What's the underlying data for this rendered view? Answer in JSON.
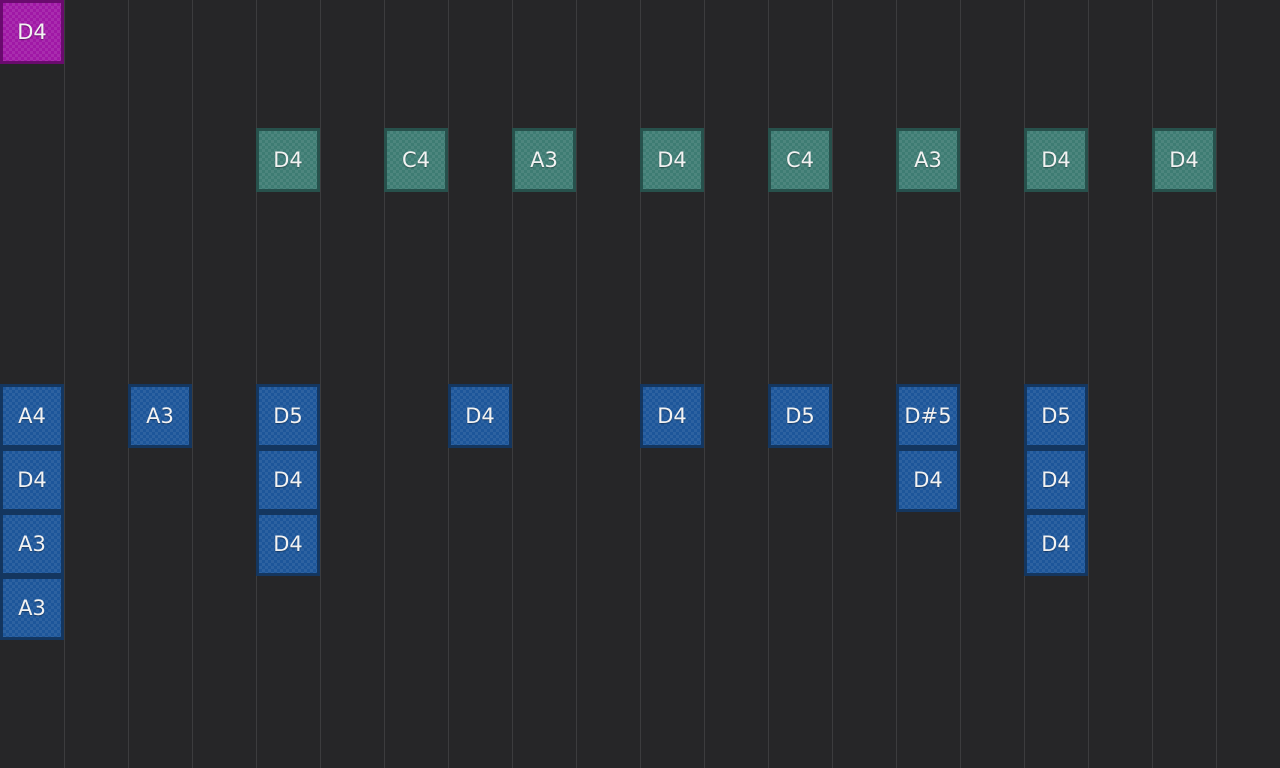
{
  "grid": {
    "columns": 20,
    "rows": 12,
    "background_color": "#262628",
    "line_color": "#3c3c3e"
  },
  "colors": {
    "blue": "#1d569a",
    "teal": "#3e7c73",
    "magenta": "#a018a6"
  },
  "notes": [
    {
      "col": 0,
      "row": 0,
      "label": "D4",
      "color": "magenta"
    },
    {
      "col": 4,
      "row": 2,
      "label": "D4",
      "color": "teal"
    },
    {
      "col": 6,
      "row": 2,
      "label": "C4",
      "color": "teal"
    },
    {
      "col": 8,
      "row": 2,
      "label": "A3",
      "color": "teal"
    },
    {
      "col": 10,
      "row": 2,
      "label": "D4",
      "color": "teal"
    },
    {
      "col": 12,
      "row": 2,
      "label": "C4",
      "color": "teal"
    },
    {
      "col": 14,
      "row": 2,
      "label": "A3",
      "color": "teal"
    },
    {
      "col": 16,
      "row": 2,
      "label": "D4",
      "color": "teal"
    },
    {
      "col": 18,
      "row": 2,
      "label": "D4",
      "color": "teal"
    },
    {
      "col": 0,
      "row": 6,
      "label": "A4",
      "color": "blue"
    },
    {
      "col": 0,
      "row": 7,
      "label": "D4",
      "color": "blue"
    },
    {
      "col": 0,
      "row": 8,
      "label": "A3",
      "color": "blue"
    },
    {
      "col": 0,
      "row": 9,
      "label": "A3",
      "color": "blue"
    },
    {
      "col": 2,
      "row": 6,
      "label": "A3",
      "color": "blue"
    },
    {
      "col": 4,
      "row": 6,
      "label": "D5",
      "color": "blue"
    },
    {
      "col": 4,
      "row": 7,
      "label": "D4",
      "color": "blue"
    },
    {
      "col": 4,
      "row": 8,
      "label": "D4",
      "color": "blue"
    },
    {
      "col": 7,
      "row": 6,
      "label": "D4",
      "color": "blue"
    },
    {
      "col": 10,
      "row": 6,
      "label": "D4",
      "color": "blue"
    },
    {
      "col": 12,
      "row": 6,
      "label": "D5",
      "color": "blue"
    },
    {
      "col": 14,
      "row": 6,
      "label": "D#5",
      "color": "blue"
    },
    {
      "col": 14,
      "row": 7,
      "label": "D4",
      "color": "blue"
    },
    {
      "col": 16,
      "row": 6,
      "label": "D5",
      "color": "blue"
    },
    {
      "col": 16,
      "row": 7,
      "label": "D4",
      "color": "blue"
    },
    {
      "col": 16,
      "row": 8,
      "label": "D4",
      "color": "blue"
    }
  ]
}
